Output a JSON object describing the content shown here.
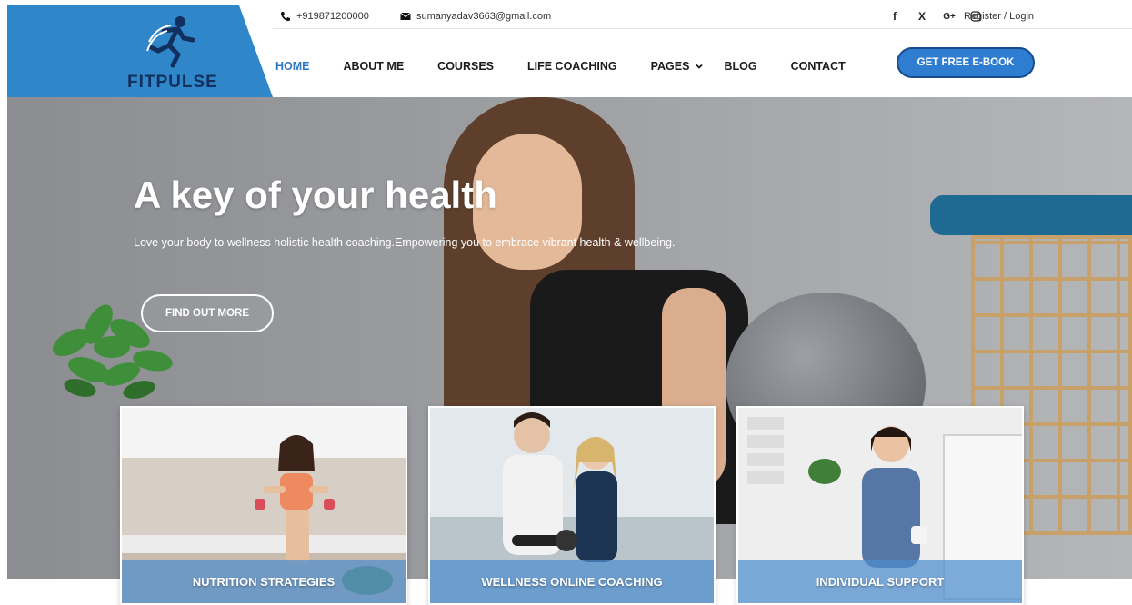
{
  "brand": {
    "name": "FITPULSE",
    "color": "#2f86c9",
    "text_color": "#12305e"
  },
  "topbar": {
    "phone": "+919871200000",
    "email": "sumanyadav3663@gmail.com",
    "social": [
      {
        "icon": "facebook-icon",
        "label": "f"
      },
      {
        "icon": "x-icon",
        "label": "X"
      },
      {
        "icon": "google-plus-icon",
        "label": "G+"
      },
      {
        "icon": "instagram-icon",
        "label": ""
      }
    ],
    "register_login": "Register / Login"
  },
  "nav": {
    "items": [
      {
        "label": "HOME",
        "active": true
      },
      {
        "label": "ABOUT ME"
      },
      {
        "label": "COURSES"
      },
      {
        "label": "LIFE COACHING"
      },
      {
        "label": "PAGES",
        "has_dropdown": true
      },
      {
        "label": "BLOG"
      },
      {
        "label": "CONTACT"
      }
    ],
    "cta": "GET FREE E-BOOK",
    "accent": "#2f76c2"
  },
  "hero": {
    "title": "A key of your health",
    "subtitle": "Love your body to wellness holistic health coaching.Empowering you to embrace vibrant health & wellbeing.",
    "button": "FIND OUT MORE"
  },
  "cards": [
    {
      "label": "NUTRITION STRATEGIES"
    },
    {
      "label": "WELLNESS ONLINE COACHING"
    },
    {
      "label": "INDIVIDUAL SUPPORT"
    }
  ]
}
